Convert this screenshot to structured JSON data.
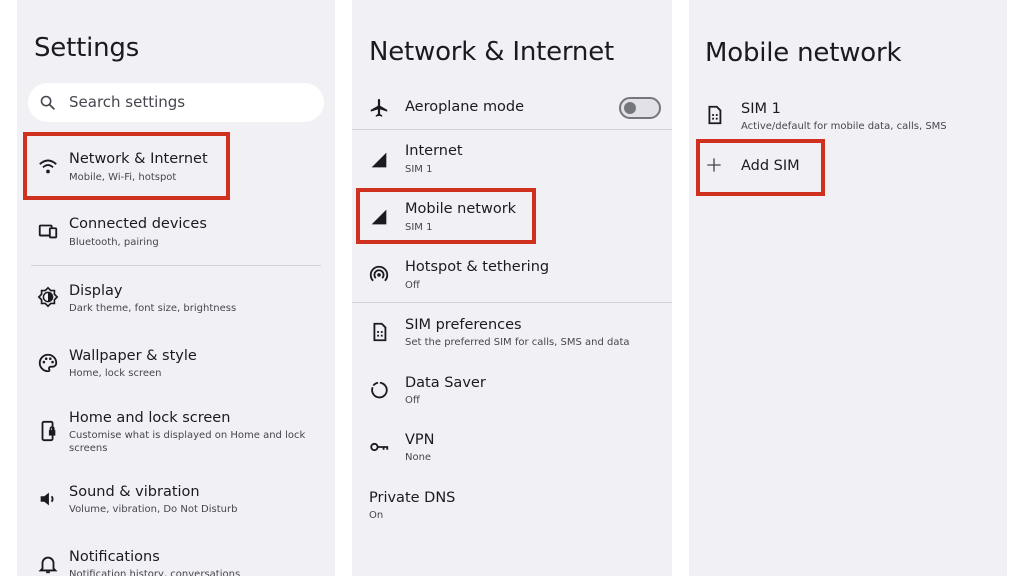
{
  "settings": {
    "title": "Settings",
    "search_placeholder": "Search settings",
    "items": [
      {
        "icon": "wifi-icon",
        "title": "Network & Internet",
        "subtitle": "Mobile, Wi-Fi, hotspot"
      },
      {
        "icon": "connected-devices-icon",
        "title": "Connected devices",
        "subtitle": "Bluetooth, pairing"
      },
      {
        "icon": "brightness-icon",
        "title": "Display",
        "subtitle": "Dark theme, font size, brightness"
      },
      {
        "icon": "palette-icon",
        "title": "Wallpaper & style",
        "subtitle": "Home, lock screen"
      },
      {
        "icon": "phone-lock-icon",
        "title": "Home and lock screen",
        "subtitle": "Customise what is displayed on Home and lock",
        "subtitle2": "screens"
      },
      {
        "icon": "speaker-icon",
        "title": "Sound & vibration",
        "subtitle": "Volume, vibration, Do Not Disturb"
      },
      {
        "icon": "bell-icon",
        "title": "Notifications",
        "subtitle": "Notification history, conversations"
      }
    ]
  },
  "network": {
    "title": "Network & Internet",
    "items": [
      {
        "icon": "airplane-icon",
        "title": "Aeroplane mode",
        "toggle_on": false
      },
      {
        "icon": "signal-icon",
        "title": "Internet",
        "subtitle": "SIM 1"
      },
      {
        "icon": "signal-icon",
        "title": "Mobile network",
        "subtitle": "SIM 1"
      },
      {
        "icon": "hotspot-icon",
        "title": "Hotspot & tethering",
        "subtitle": "Off"
      },
      {
        "icon": "sim-card-icon",
        "title": "SIM preferences",
        "subtitle": "Set the preferred SIM for calls, SMS and data"
      },
      {
        "icon": "data-saver-icon",
        "title": "Data Saver",
        "subtitle": "Off"
      },
      {
        "icon": "vpn-key-icon",
        "title": "VPN",
        "subtitle": "None"
      },
      {
        "title": "Private DNS",
        "subtitle": "On"
      }
    ]
  },
  "mobile": {
    "title": "Mobile network",
    "sim": {
      "icon": "sim-card-icon",
      "title": "SIM 1",
      "subtitle": "Active/default for mobile data, calls, SMS"
    },
    "add": {
      "icon": "plus-icon",
      "title": "Add SIM"
    }
  },
  "colors": {
    "highlight": "#d0311f",
    "panel": "#f1f0f5",
    "text": "#1b1b1f"
  }
}
